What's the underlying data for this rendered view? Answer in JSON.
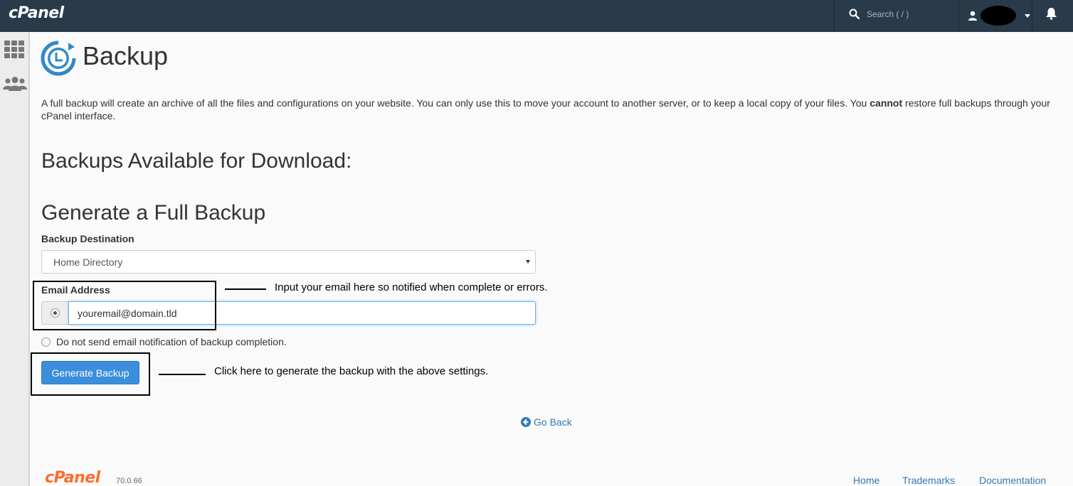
{
  "topbar": {
    "logo": "cPanel",
    "search_placeholder": "Search ( / )",
    "icons": {
      "search": "search-icon",
      "user": "user-icon",
      "bell": "bell-icon"
    },
    "background": "#293a4a"
  },
  "sidebar": {
    "icons": [
      "apps-grid-icon",
      "users-icon"
    ]
  },
  "page": {
    "title": "Backup",
    "title_icon": "backup-clock-icon",
    "intro_before": "A full backup will create an archive of all the files and configurations on your website. You can only use this to move your account to another server, or to keep a local copy of your files. You ",
    "intro_bold": "cannot",
    "intro_after": " restore full backups through your cPanel interface."
  },
  "available": {
    "heading": "Backups Available for Download:"
  },
  "generate": {
    "heading": "Generate a Full Backup",
    "destination_label": "Backup Destination",
    "destination_value": "Home Directory",
    "email_label": "Email Address",
    "email_value": "youremail@domain.tld",
    "no_email_label": "Do not send email notification of backup completion.",
    "button_label": "Generate Backup",
    "button_color": "#3b8edb"
  },
  "annotations": {
    "email_note": "Input your email here so notified when complete or errors.",
    "button_note": "Click here to generate the backup with the above settings."
  },
  "go_back": "Go Back",
  "footer": {
    "logo": "cPanel",
    "version": "70.0.66",
    "links": [
      "Home",
      "Trademarks",
      "Documentation"
    ]
  }
}
